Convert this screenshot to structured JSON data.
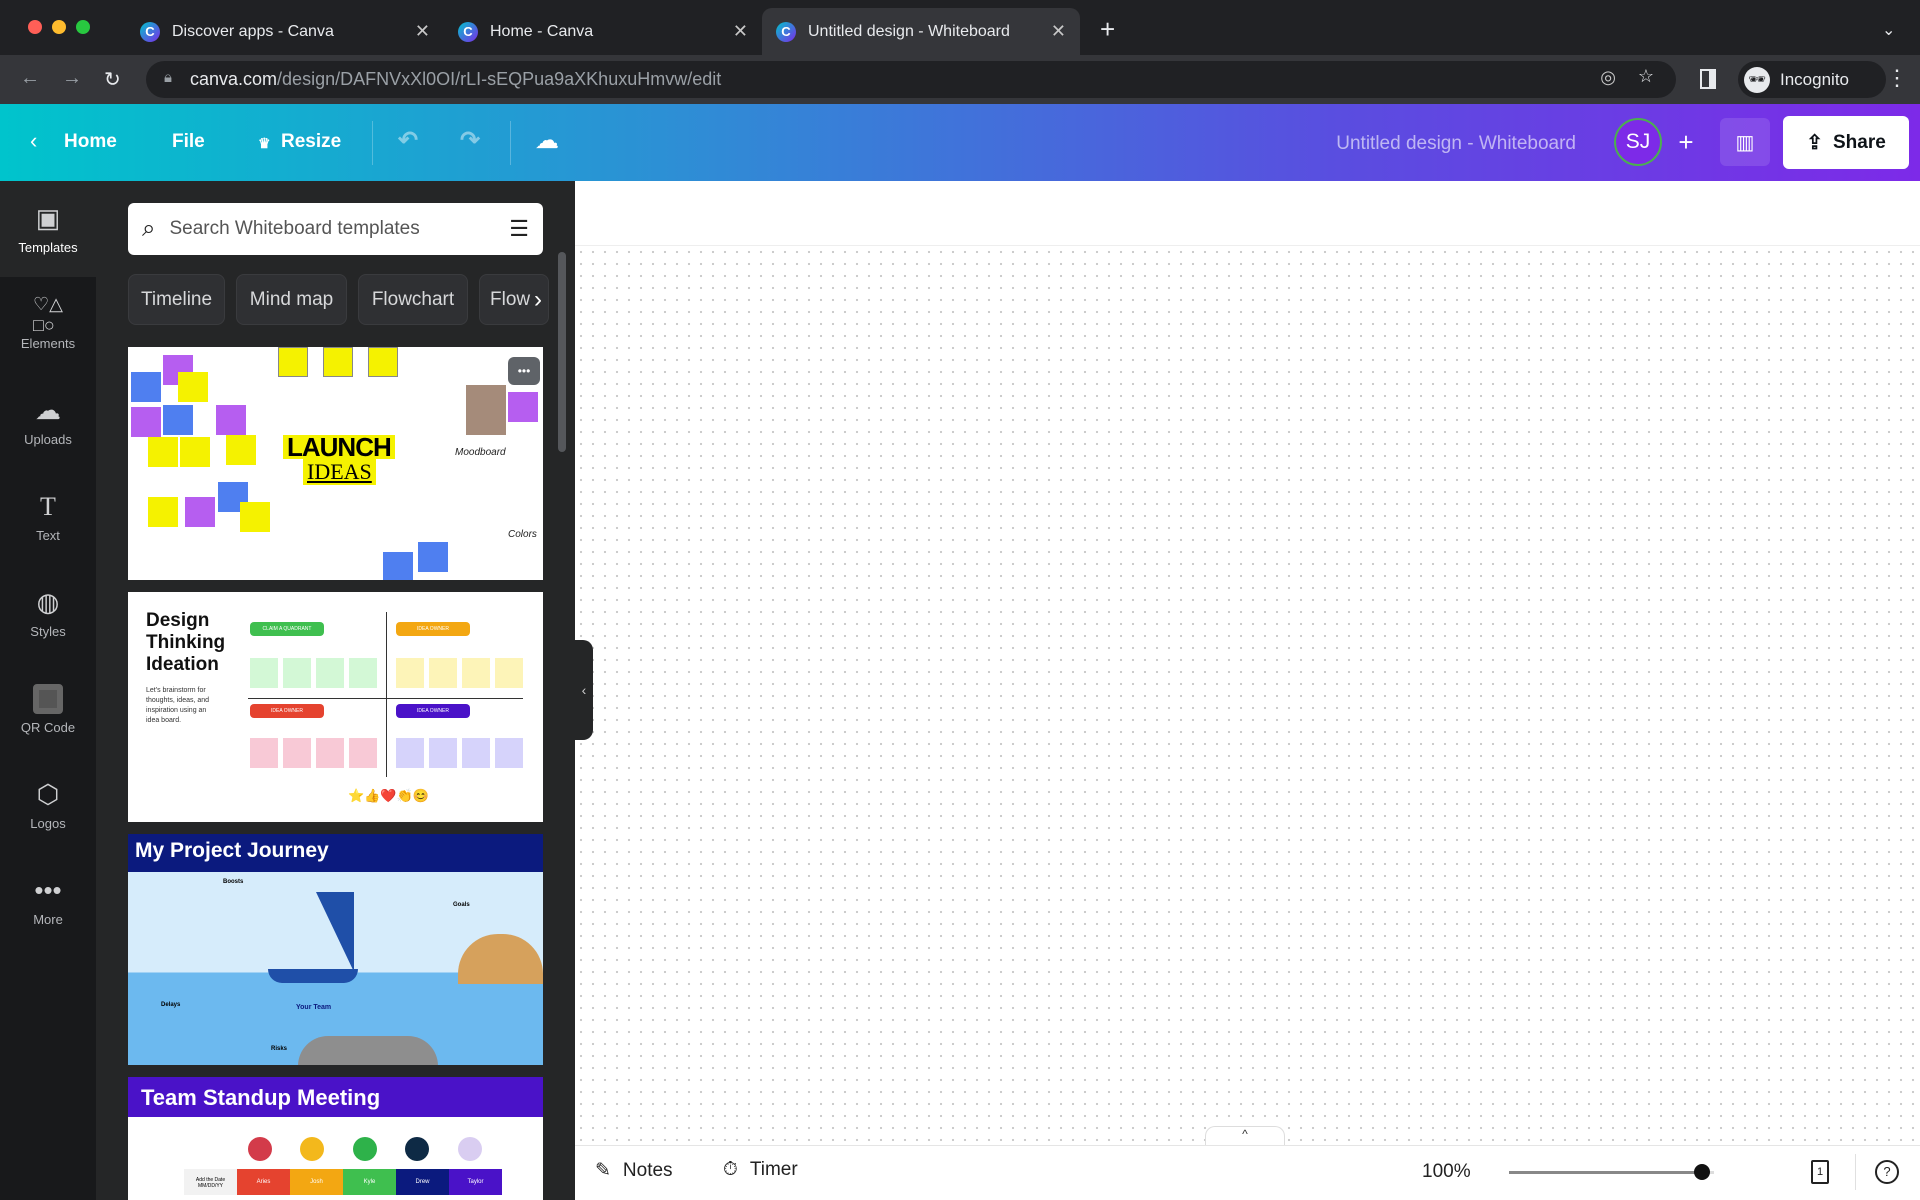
{
  "browser": {
    "tabs": [
      {
        "title": "Discover apps - Canva",
        "active": false
      },
      {
        "title": "Home - Canva",
        "active": false
      },
      {
        "title": "Untitled design - Whiteboard",
        "active": true
      }
    ],
    "new_tab": "+",
    "url_host": "canva.com",
    "url_path": "/design/DAFNVxXl0OI/rLI-sEQPua9aXKhuxuHmvw/edit",
    "profile": "Incognito"
  },
  "header": {
    "home": "Home",
    "file": "File",
    "resize": "Resize",
    "doc_title": "Untitled design - Whiteboard",
    "avatar": "SJ",
    "add": "+",
    "share": "Share"
  },
  "rail": [
    {
      "label": "Templates",
      "icon": "templates-icon"
    },
    {
      "label": "Elements",
      "icon": "elements-icon"
    },
    {
      "label": "Uploads",
      "icon": "upload-cloud-icon"
    },
    {
      "label": "Text",
      "icon": "text-icon"
    },
    {
      "label": "Styles",
      "icon": "palette-icon"
    },
    {
      "label": "QR Code",
      "icon": "qr-icon"
    },
    {
      "label": "Logos",
      "icon": "logo-icon"
    },
    {
      "label": "More",
      "icon": "more-icon"
    }
  ],
  "panel": {
    "search_placeholder": "Search Whiteboard templates",
    "chips": [
      "Timeline",
      "Mind map",
      "Flowchart",
      "Flow"
    ],
    "templates": [
      {
        "title1": "LAUNCH",
        "title2": "IDEAS",
        "moodboard": "Moodboard",
        "colors": "Colors"
      },
      {
        "title": "Design Thinking Ideation",
        "desc": "Let's brainstorm for thoughts, ideas, and inspiration using an idea board.",
        "tags": [
          "CLAIM A QUADRANT",
          "IDEA OWNER",
          "IDEA OWNER",
          "IDEA OWNER"
        ]
      },
      {
        "title": "My Project Journey",
        "boosts": "Boosts",
        "goals": "Goals",
        "delays": "Delays",
        "risks": "Risks",
        "team": "Your Team"
      },
      {
        "title": "Team Standup Meeting",
        "names": [
          "Aries",
          "Josh",
          "Kyle",
          "Drew",
          "Taylor"
        ],
        "date": "Add the Date MM/DD/YY"
      }
    ]
  },
  "bottom": {
    "notes": "Notes",
    "timer": "Timer",
    "zoom": "100%",
    "zoom_level": 100,
    "page": "1",
    "help": "?"
  }
}
